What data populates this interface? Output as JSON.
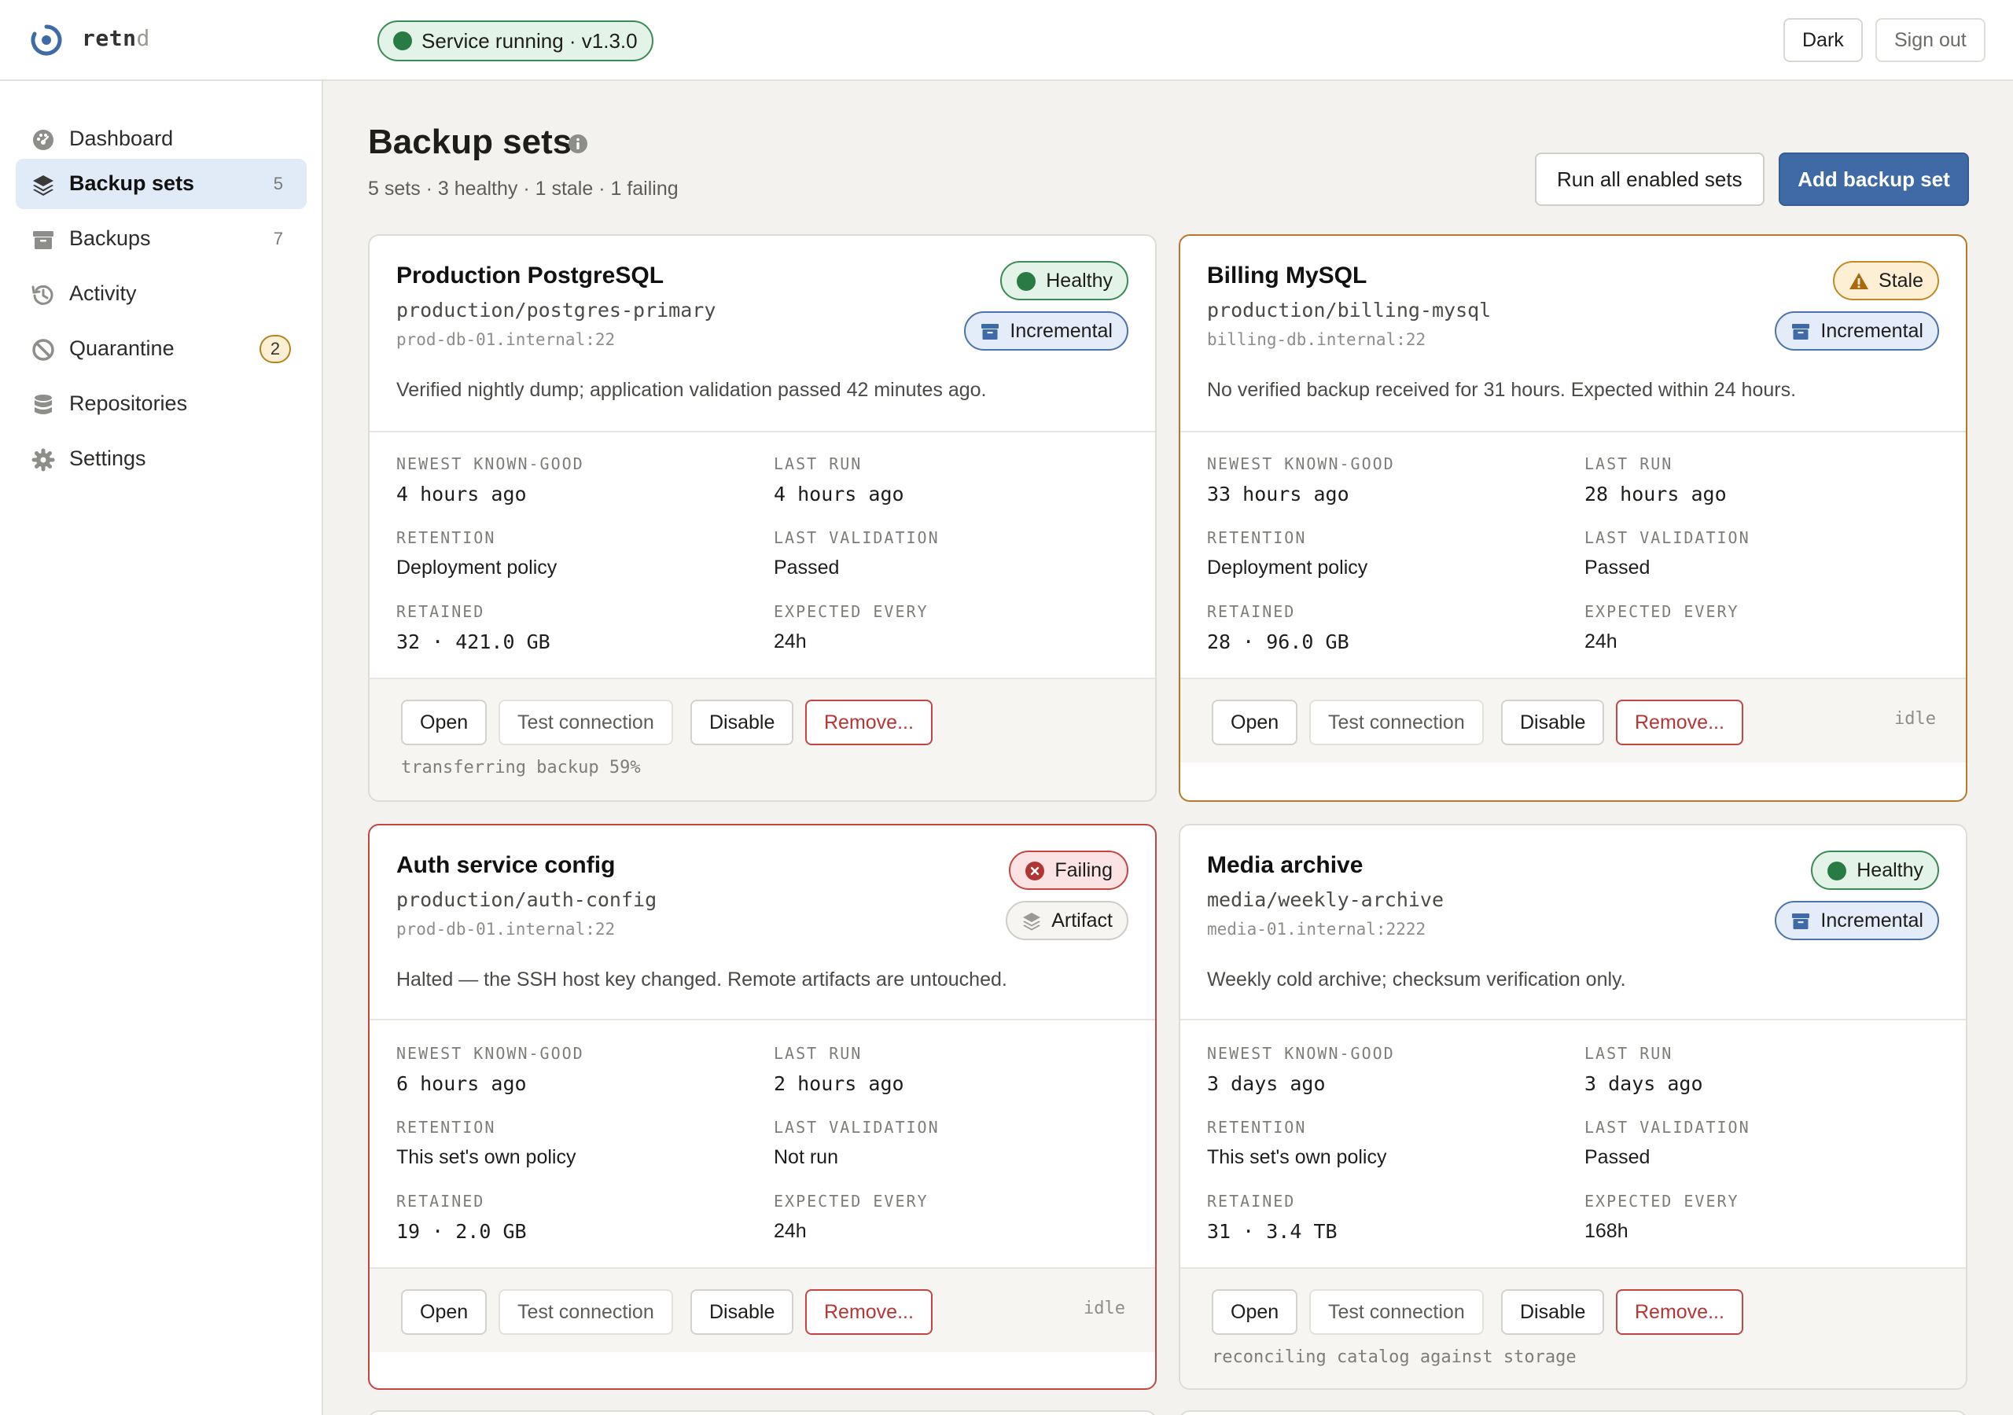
{
  "app": {
    "brand": "retn",
    "brand_dim": "d",
    "service_status": "Service running · v1.3.0",
    "dark_label": "Dark",
    "signout_label": "Sign out"
  },
  "sidebar": {
    "items": [
      {
        "label": "Dashboard",
        "icon": "dashboard-icon"
      },
      {
        "label": "Backup sets",
        "icon": "layers-icon",
        "count": "5",
        "active": true
      },
      {
        "label": "Backups",
        "icon": "archive-box-icon",
        "count": "7"
      },
      {
        "label": "Activity",
        "icon": "history-icon"
      },
      {
        "label": "Quarantine",
        "icon": "blocked-icon",
        "badge": "2"
      },
      {
        "label": "Repositories",
        "icon": "database-icon"
      },
      {
        "label": "Settings",
        "icon": "gear-icon"
      }
    ]
  },
  "header": {
    "title": "Backup sets",
    "summary": "5 sets · 3 healthy · 1 stale · 1 failing",
    "run_all_label": "Run all enabled sets",
    "add_label": "Add backup set"
  },
  "labels": {
    "newest": "NEWEST KNOWN-GOOD",
    "last_run": "LAST RUN",
    "retention": "RETENTION",
    "last_validation": "LAST VALIDATION",
    "retained": "RETAINED",
    "expected": "EXPECTED EVERY",
    "open": "Open",
    "test": "Test connection",
    "disable": "Disable",
    "remove": "Remove..."
  },
  "colors": {
    "accent": "#3f6aa6",
    "healthy": "#2a7a43",
    "stale": "#b9782b",
    "failing": "#c54545"
  },
  "cards": [
    {
      "name": "Production PostgreSQL",
      "path": "production/postgres-primary",
      "host": "prod-db-01.internal:22",
      "status": "Healthy",
      "kind": "Incremental",
      "description": "Verified nightly dump; application validation passed 42 minutes ago.",
      "newest": "4 hours ago",
      "last_run": "4 hours ago",
      "retention": "Deployment policy",
      "last_validation": "Passed",
      "retained": "32 · 421.0 GB",
      "expected": "24h",
      "foot_state": "",
      "foot_note": "transferring backup 59%"
    },
    {
      "name": "Billing MySQL",
      "path": "production/billing-mysql",
      "host": "billing-db.internal:22",
      "status": "Stale",
      "kind": "Incremental",
      "description": "No verified backup received for 31 hours. Expected within 24 hours.",
      "newest": "33 hours ago",
      "last_run": "28 hours ago",
      "retention": "Deployment policy",
      "last_validation": "Passed",
      "retained": "28 · 96.0 GB",
      "expected": "24h",
      "foot_state": "idle",
      "foot_note": ""
    },
    {
      "name": "Auth service config",
      "path": "production/auth-config",
      "host": "prod-db-01.internal:22",
      "status": "Failing",
      "kind": "Artifact",
      "description": "Halted — the SSH host key changed. Remote artifacts are untouched.",
      "newest": "6 hours ago",
      "last_run": "2 hours ago",
      "retention": "This set's own policy",
      "last_validation": "Not run",
      "retained": "19 · 2.0 GB",
      "expected": "24h",
      "foot_state": "idle",
      "foot_note": ""
    },
    {
      "name": "Media archive",
      "path": "media/weekly-archive",
      "host": "media-01.internal:2222",
      "status": "Healthy",
      "kind": "Incremental",
      "description": "Weekly cold archive; checksum verification only.",
      "newest": "3 days ago",
      "last_run": "3 days ago",
      "retention": "This set's own policy",
      "last_validation": "Passed",
      "retained": "31 · 3.4 TB",
      "expected": "168h",
      "foot_state": "",
      "foot_note": "reconciling catalog against storage"
    }
  ]
}
